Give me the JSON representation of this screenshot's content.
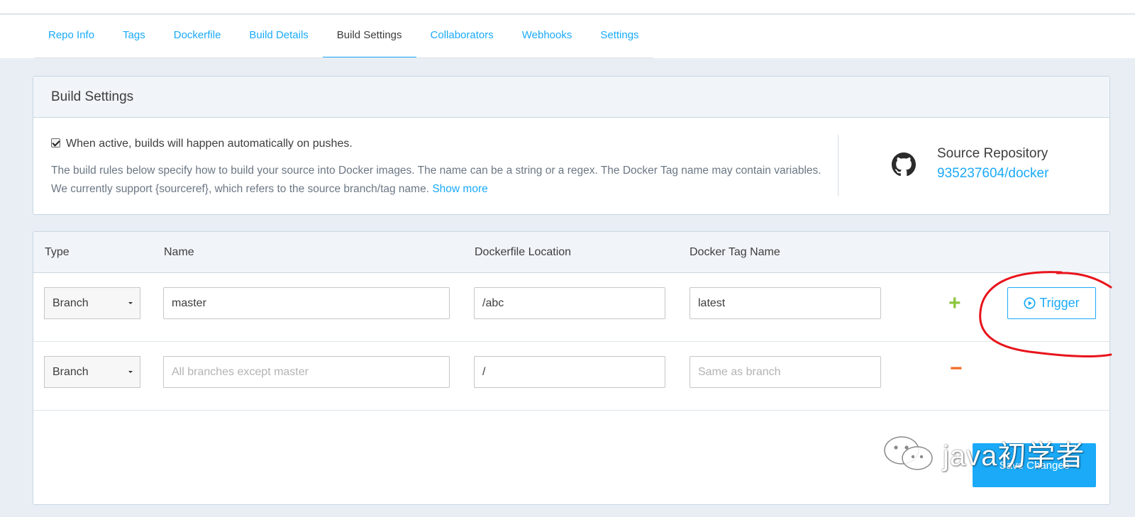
{
  "tabs": [
    {
      "label": "Repo Info",
      "active": false
    },
    {
      "label": "Tags",
      "active": false
    },
    {
      "label": "Dockerfile",
      "active": false
    },
    {
      "label": "Build Details",
      "active": false
    },
    {
      "label": "Build Settings",
      "active": true
    },
    {
      "label": "Collaborators",
      "active": false
    },
    {
      "label": "Webhooks",
      "active": false
    },
    {
      "label": "Settings",
      "active": false
    }
  ],
  "build_settings": {
    "title": "Build Settings",
    "autobuild_checked": true,
    "autobuild_label": "When active, builds will happen automatically on pushes.",
    "description": "The build rules below specify how to build your source into Docker images. The name can be a string or a regex. The Docker Tag name may contain variables. We currently support {sourceref}, which refers to the source branch/tag name.",
    "show_more": "Show more",
    "source_repo_label": "Source Repository",
    "source_repo_link": "935237604/docker",
    "source_icon": "github-icon"
  },
  "rules": {
    "columns": {
      "type": "Type",
      "name": "Name",
      "location": "Dockerfile Location",
      "tag": "Docker Tag Name"
    },
    "rows": [
      {
        "type": "Branch",
        "name_value": "master",
        "name_placeholder": "",
        "location_value": "/abc",
        "tag_value": "latest",
        "tag_placeholder": "",
        "action": "plus",
        "trigger_label": "Trigger"
      },
      {
        "type": "Branch",
        "name_value": "",
        "name_placeholder": "All branches except master",
        "location_value": "/",
        "tag_value": "",
        "tag_placeholder": "Same as branch",
        "action": "minus"
      }
    ],
    "plus_symbol": "+",
    "minus_symbol": "−",
    "save_label": "Save Changes"
  },
  "watermark": {
    "text": "java初学者",
    "icon": "wechat-icon"
  },
  "colors": {
    "accent": "#1aaaf8",
    "plus": "#8cc63f",
    "minus": "#f26b26",
    "annotation": "#e8141c"
  }
}
